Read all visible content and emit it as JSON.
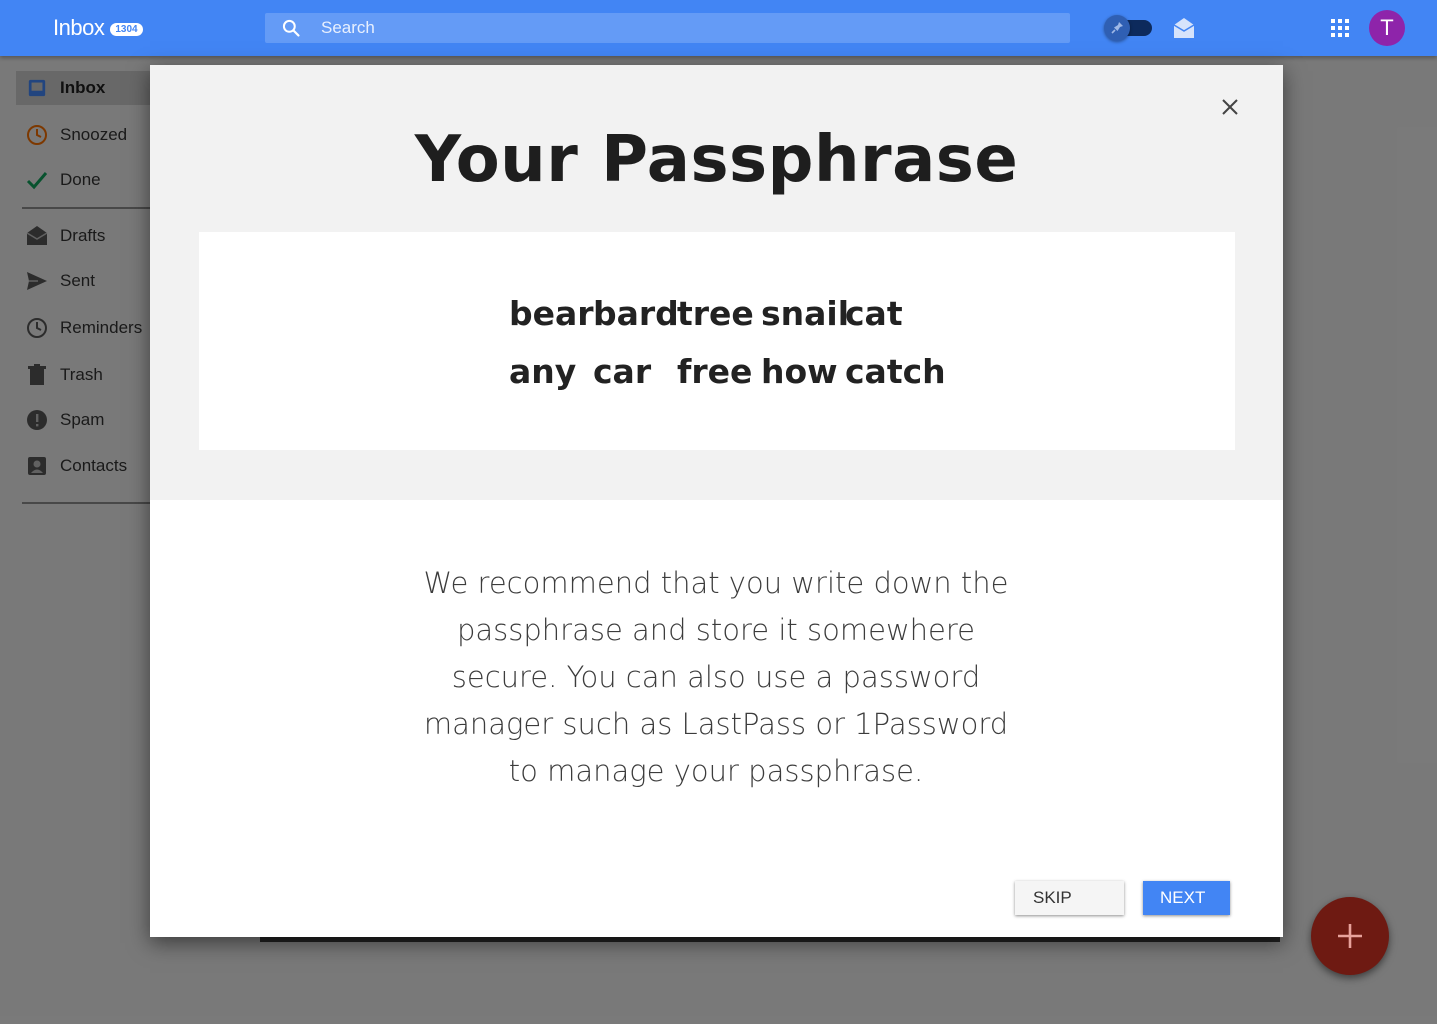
{
  "header": {
    "title": "Inbox",
    "unread_count": "1304",
    "search_placeholder": "Search",
    "avatar_letter": "T"
  },
  "sidebar": {
    "items": [
      {
        "label": "Inbox",
        "icon": "inbox-icon"
      },
      {
        "label": "Snoozed",
        "icon": "clock-icon"
      },
      {
        "label": "Done",
        "icon": "check-icon"
      },
      {
        "label": "Drafts",
        "icon": "drafts-icon"
      },
      {
        "label": "Sent",
        "icon": "send-icon"
      },
      {
        "label": "Reminders",
        "icon": "reminder-icon"
      },
      {
        "label": "Trash",
        "icon": "trash-icon"
      },
      {
        "label": "Spam",
        "icon": "spam-icon"
      },
      {
        "label": "Contacts",
        "icon": "contacts-icon"
      }
    ]
  },
  "modal": {
    "title": "Your Passphrase",
    "words": [
      "bear",
      "bard",
      "tree",
      "snail",
      "cat",
      "any",
      "car",
      "free",
      "how",
      "catch"
    ],
    "recommendation": "We recommend that you write down the passphrase and store it somewhere secure. You can also use a password manager such as LastPass or 1Password to manage your passphrase.",
    "skip_label": "SKIP",
    "next_label": "NEXT"
  },
  "colors": {
    "brand": "#4285f4",
    "fab": "#d23f31",
    "next_button": "#4285f4"
  }
}
